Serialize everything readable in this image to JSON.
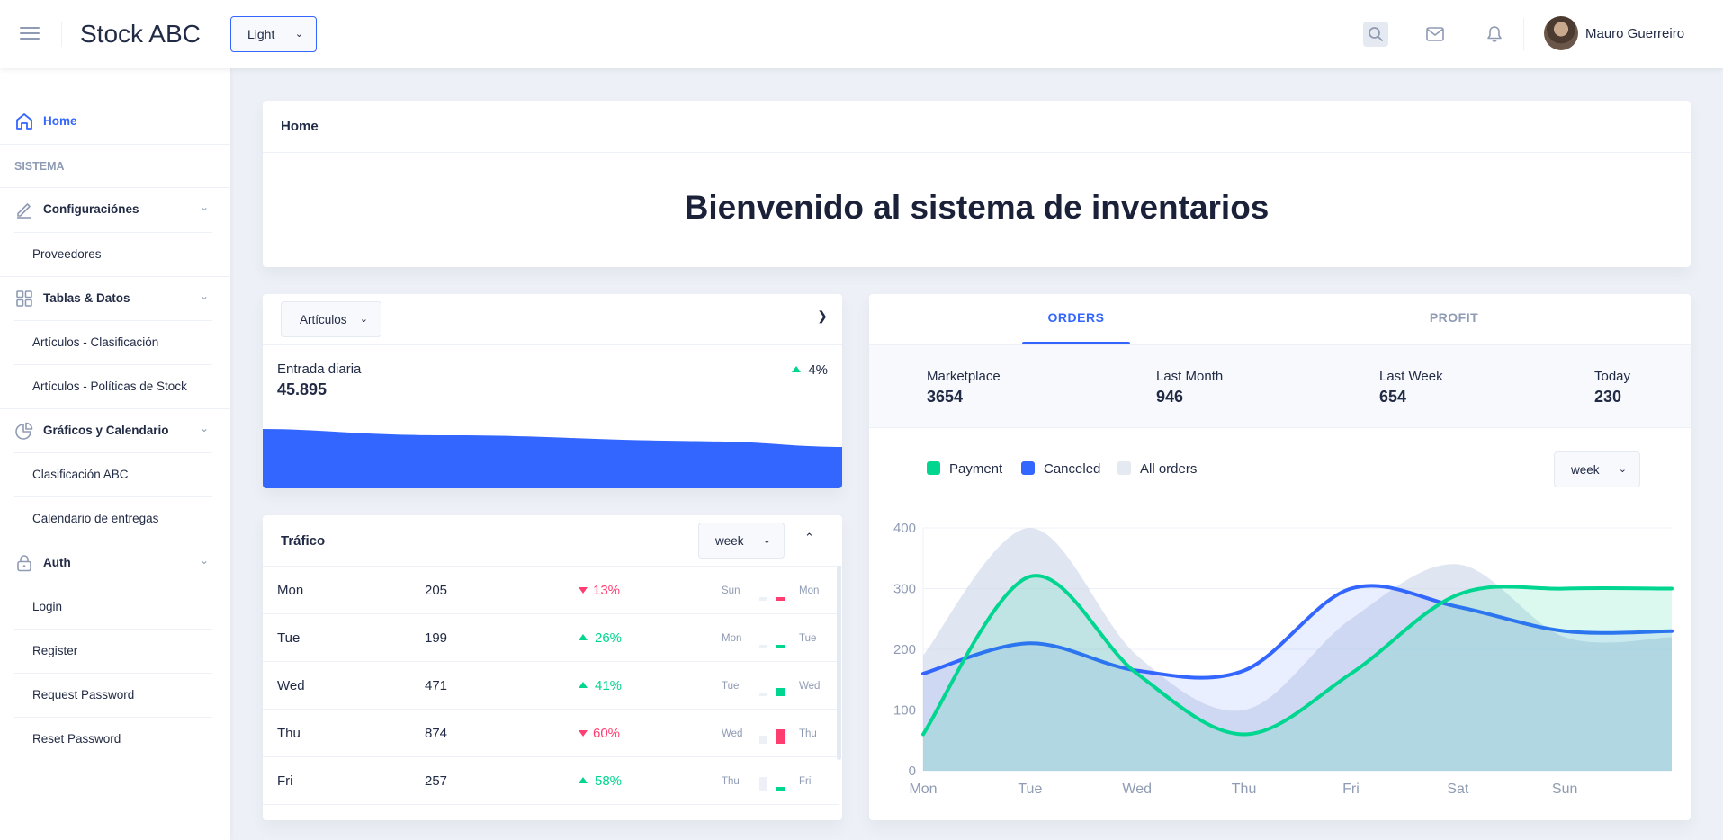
{
  "header": {
    "app_title": "Stock ABC",
    "theme": "Light",
    "user_name": "Mauro Guerreiro",
    "icons": [
      "menu-icon",
      "search-icon",
      "mail-icon",
      "bell-icon"
    ]
  },
  "sidebar": {
    "home": "Home",
    "group_label": "SISTEMA",
    "sections": [
      {
        "label": "Configuraciónes",
        "icon": "edit-icon",
        "children": [
          "Proveedores"
        ]
      },
      {
        "label": "Tablas & Datos",
        "icon": "grid-icon",
        "children": [
          "Artículos - Clasificación",
          "Artículos - Políticas de Stock"
        ]
      },
      {
        "label": "Gráficos y Calendario",
        "icon": "pie-chart-icon",
        "children": [
          "Clasificación ABC",
          "Calendario de entregas"
        ]
      },
      {
        "label": "Auth",
        "icon": "lock-icon",
        "children": [
          "Login",
          "Register",
          "Request Password",
          "Reset Password"
        ]
      }
    ]
  },
  "welcome": {
    "breadcrumb": "Home",
    "title": "Bienvenido al sistema de inventarios"
  },
  "articulos": {
    "select": "Artículos",
    "label": "Entrada diaria",
    "value": "45.895",
    "delta": "4%"
  },
  "trafico": {
    "title": "Tráfico",
    "period": "week",
    "rows": [
      {
        "day": "Mon",
        "value": "205",
        "pct": "13%",
        "dir": "down",
        "prev": "Sun",
        "curr": "Mon"
      },
      {
        "day": "Tue",
        "value": "199",
        "pct": "26%",
        "dir": "up",
        "prev": "Mon",
        "curr": "Tue"
      },
      {
        "day": "Wed",
        "value": "471",
        "pct": "41%",
        "dir": "up",
        "prev": "Tue",
        "curr": "Wed"
      },
      {
        "day": "Thu",
        "value": "874",
        "pct": "60%",
        "dir": "down",
        "prev": "Wed",
        "curr": "Thu"
      },
      {
        "day": "Fri",
        "value": "257",
        "pct": "58%",
        "dir": "up",
        "prev": "Thu",
        "curr": "Fri"
      }
    ]
  },
  "orders": {
    "tabs": [
      "ORDERS",
      "PROFIT"
    ],
    "active_tab": "ORDERS",
    "stats": [
      {
        "label": "Marketplace",
        "value": "3654"
      },
      {
        "label": "Last Month",
        "value": "946"
      },
      {
        "label": "Last Week",
        "value": "654"
      },
      {
        "label": "Today",
        "value": "230"
      }
    ],
    "legend": [
      "Payment",
      "Canceled",
      "All orders"
    ],
    "period": "week"
  },
  "colors": {
    "accent": "#3366ff",
    "success": "#00d68f",
    "danger": "#ff3d71",
    "muted": "#8f9bb3"
  },
  "chart_data": {
    "type": "area",
    "categories": [
      "Mon",
      "Tue",
      "Wed",
      "Thu",
      "Fri",
      "Sat",
      "Sun"
    ],
    "ylim": [
      0,
      400
    ],
    "yticks": [
      0,
      100,
      200,
      300,
      400
    ],
    "series": [
      {
        "name": "Payment",
        "color": "#00d68f",
        "values": [
          60,
          320,
          160,
          60,
          160,
          290,
          300
        ]
      },
      {
        "name": "Canceled",
        "color": "#3366ff",
        "values": [
          160,
          210,
          165,
          165,
          300,
          270,
          230
        ]
      },
      {
        "name": "All orders",
        "color": "#e4e9f2",
        "values": [
          190,
          400,
          190,
          100,
          250,
          340,
          220
        ]
      }
    ]
  }
}
